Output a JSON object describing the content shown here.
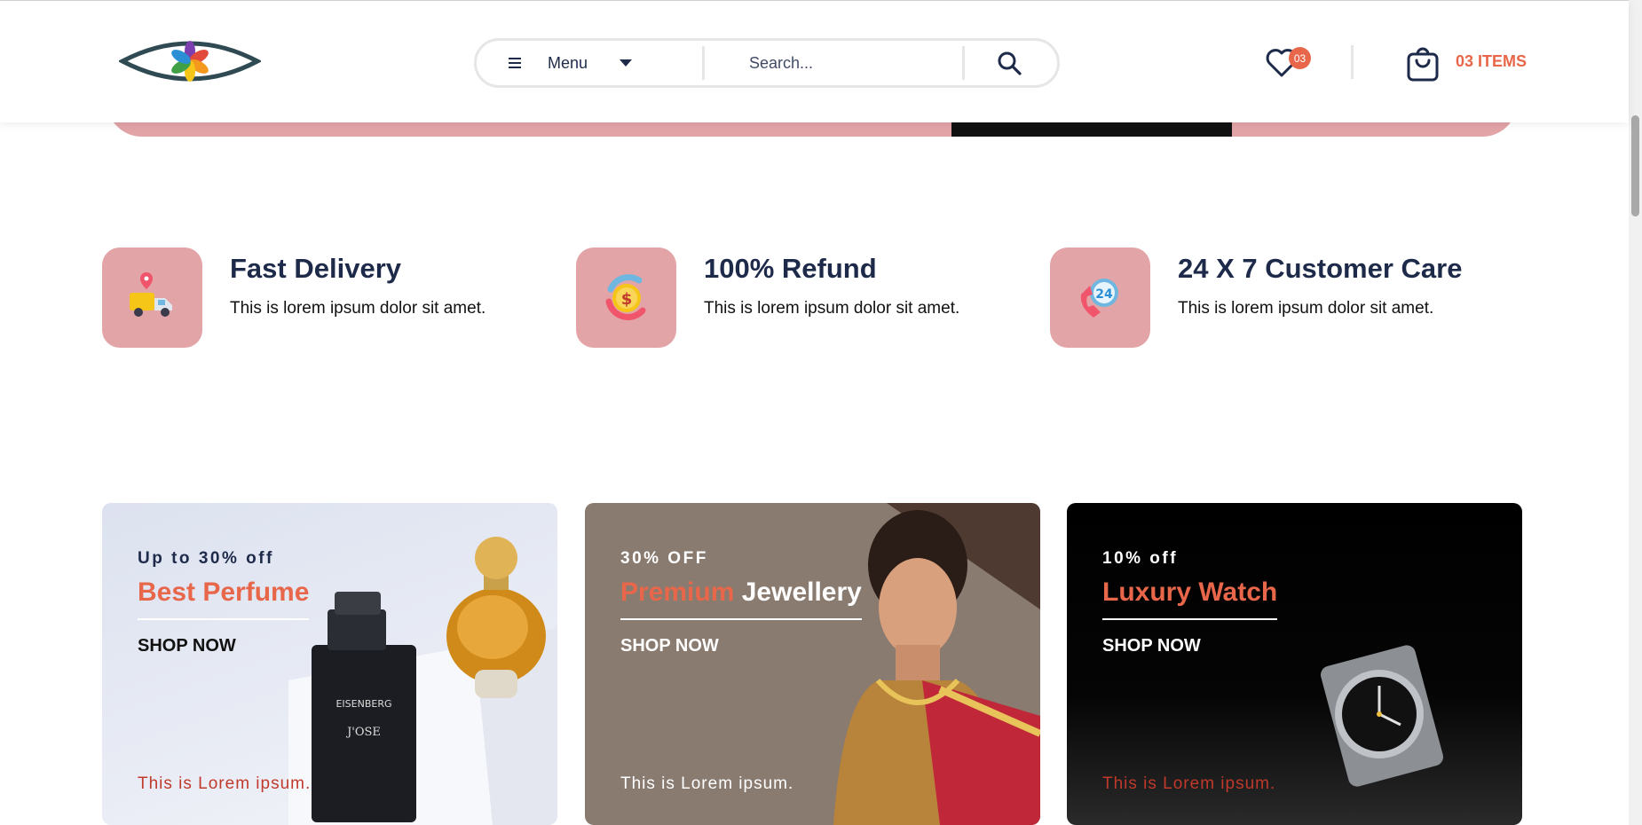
{
  "header": {
    "menu_label": "Menu",
    "search_placeholder": "Search...",
    "wishlist_count": "03",
    "cart_label": "03 ITEMS"
  },
  "features": [
    {
      "title": "Fast Delivery",
      "text": "This is lorem ipsum dolor sit amet.",
      "icon": "delivery-truck-icon"
    },
    {
      "title": "100% Refund",
      "text": "This is lorem ipsum dolor sit amet.",
      "icon": "refund-coin-icon"
    },
    {
      "title": "24 X 7 Customer Care",
      "text": "This is lorem ipsum dolor sit amet.",
      "icon": "customer-care-24-icon"
    }
  ],
  "cards": [
    {
      "eyebrow": "Up to 30% off",
      "title_accent": "Best Perfume",
      "title_rest": "",
      "cta": "SHOP NOW",
      "footer": "This is Lorem ipsum."
    },
    {
      "eyebrow": "30% OFF",
      "title_accent": "Premium",
      "title_rest": "Jewellery",
      "cta": "SHOP NOW",
      "footer": "This is Lorem ipsum."
    },
    {
      "eyebrow": "10% off",
      "title_accent": "Luxury Watch",
      "title_rest": "",
      "cta": "SHOP NOW",
      "footer": "This is Lorem ipsum."
    }
  ],
  "colors": {
    "accent": "#e8674a",
    "navy": "#1e2a4a",
    "pink": "#e2a4a7"
  }
}
